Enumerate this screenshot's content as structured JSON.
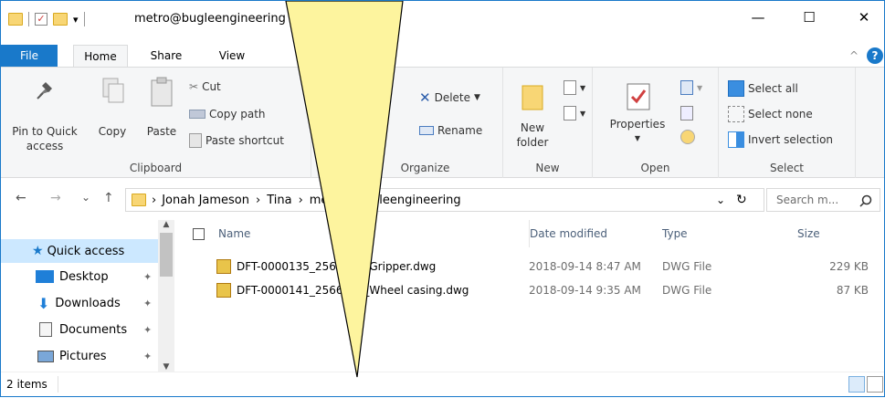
{
  "window": {
    "title": "metro@bugleengineering",
    "qat_dropdown": "▾",
    "controls": {
      "minimize": "—",
      "maximize": "☐",
      "close": "✕"
    }
  },
  "tabs": {
    "file": "File",
    "home": "Home",
    "share": "Share",
    "view": "View",
    "collapse": "^",
    "help": "?"
  },
  "ribbon": {
    "clipboard": {
      "label": "Clipboard",
      "pin": "Pin to Quick access",
      "copy": "Copy",
      "paste": "Paste",
      "cut": "Cut",
      "copy_path": "Copy path",
      "paste_shortcut": "Paste shortcut"
    },
    "organize": {
      "label": "Organize",
      "delete": "Delete",
      "rename": "Rename"
    },
    "new": {
      "label": "New",
      "new_folder": "New folder"
    },
    "open": {
      "label": "Open",
      "properties": "Properties"
    },
    "select": {
      "label": "Select",
      "select_all": "Select all",
      "select_none": "Select none",
      "invert": "Invert selection"
    }
  },
  "address": {
    "back": "←",
    "forward": "→",
    "recent": "⌄",
    "up": "↑",
    "crumbs": [
      "Jonah Jameson",
      "Tina",
      "metro@bugleengineering"
    ],
    "crumb_sep": "›",
    "dropdown": "⌄",
    "refresh": "↻",
    "search_placeholder": "Search m..."
  },
  "nav": {
    "quick_access": "Quick access",
    "items": [
      "Desktop",
      "Downloads",
      "Documents",
      "Pictures"
    ],
    "pin_glyph": "📌"
  },
  "list": {
    "columns": {
      "name": "Name",
      "date": "Date modified",
      "type": "Type",
      "size": "Size"
    },
    "rows": [
      {
        "name": "DFT-0000135_2566213_Gripper.dwg",
        "date": "2018-09-14 8:47 AM",
        "type": "DWG File",
        "size": "229 KB"
      },
      {
        "name": "DFT-0000141_2566416_Wheel casing.dwg",
        "date": "2018-09-14 9:35 AM",
        "type": "DWG File",
        "size": "87 KB"
      }
    ]
  },
  "status": {
    "count": "2 items"
  },
  "colors": {
    "accent": "#1979ca",
    "callout_fill": "#fdf49e",
    "selection": "#cce8ff"
  }
}
